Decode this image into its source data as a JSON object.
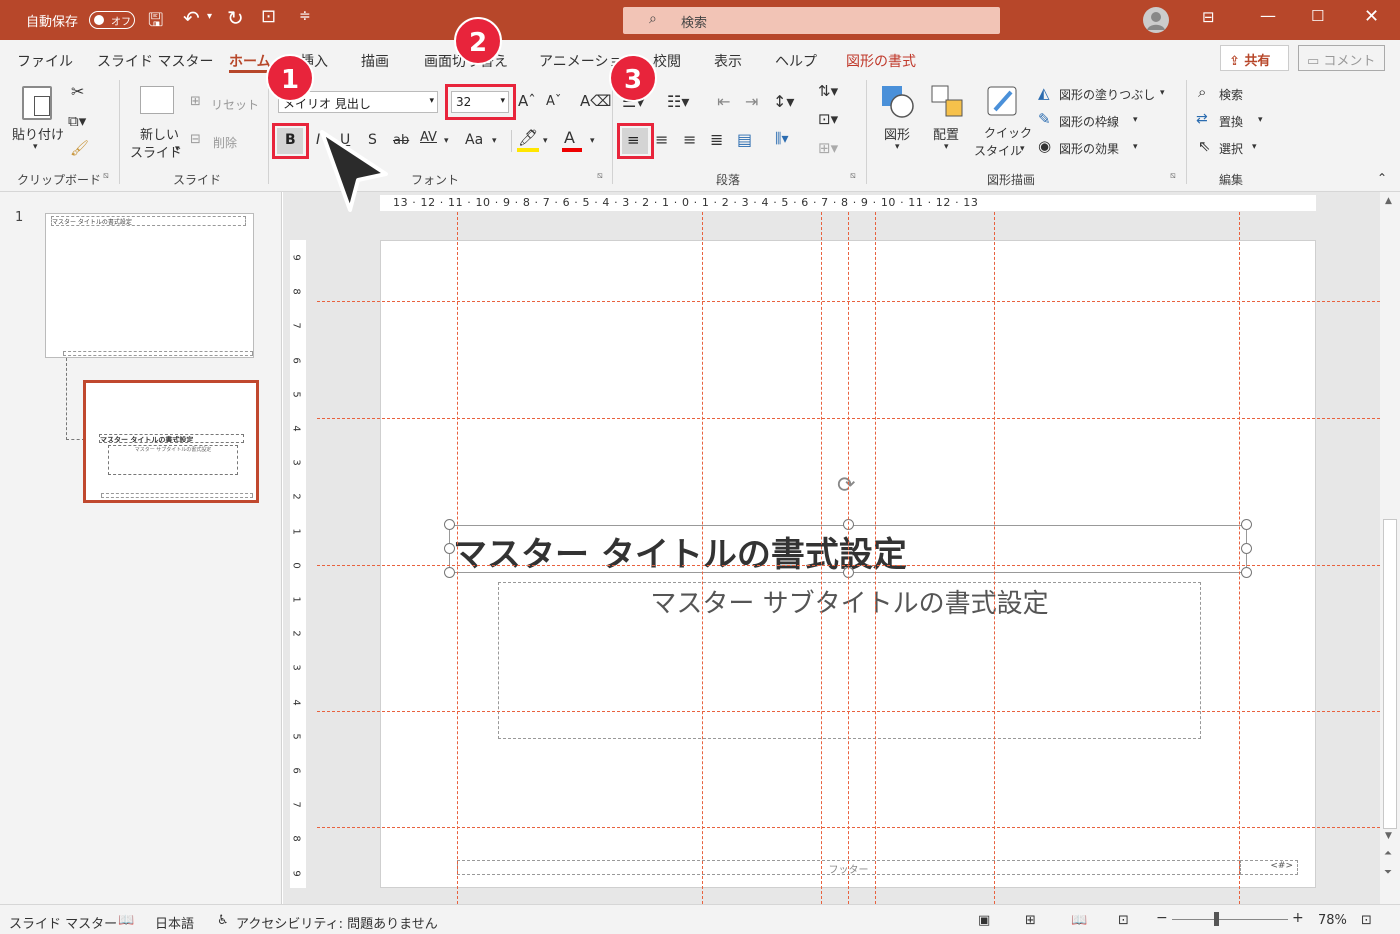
{
  "titlebar": {
    "autosave_label": "自動保存",
    "autosave_state": "オフ",
    "search_placeholder": "検索"
  },
  "tabs": [
    {
      "label": "ファイル"
    },
    {
      "label": "スライド マスター"
    },
    {
      "label": "ホーム"
    },
    {
      "label": "挿入"
    },
    {
      "label": "描画"
    },
    {
      "label": "画面切り替え"
    },
    {
      "label": "アニメーション"
    },
    {
      "label": "校閲"
    },
    {
      "label": "表示"
    },
    {
      "label": "ヘルプ"
    },
    {
      "label": "図形の書式"
    }
  ],
  "share_label": "共有",
  "comment_label": "コメント",
  "ribbon": {
    "clipboard": {
      "paste": "貼り付け",
      "group": "クリップボード"
    },
    "slides": {
      "new_slide_1": "新しい",
      "new_slide_2": "スライド",
      "reset": "リセット",
      "delete": "削除",
      "group": "スライド"
    },
    "font": {
      "font_name": "メイリオ 見出し",
      "font_size": "32",
      "bold": "B",
      "italic": "I",
      "underline": "U",
      "shadow": "S",
      "strike": "ab",
      "spacing": "AV",
      "case": "Aa",
      "group": "フォント"
    },
    "paragraph": {
      "group": "段落"
    },
    "drawing": {
      "shapes": "図形",
      "arrange": "配置",
      "quick_1": "クイック",
      "quick_2": "スタイル",
      "fill": "図形の塗りつぶし",
      "outline": "図形の枠線",
      "effects": "図形の効果",
      "group": "図形描画"
    },
    "editing": {
      "find": "検索",
      "replace": "置換",
      "select": "選択",
      "group": "編集"
    }
  },
  "callouts": [
    "1",
    "2",
    "3"
  ],
  "thumbnails": {
    "slide_number": "1",
    "thumb1_title": "マスター タイトルの書式設定",
    "thumb2_title": "マスター タイトルの書式設定",
    "thumb2_subtitle": "マスター サブタイトルの書式設定"
  },
  "ruler": {
    "horizontal": "13 · 12 · 11 · 10 · 9 · 8 · 7 · 6 · 5 · 4 · 3 · 2 · 1 · 0 · 1 · 2 · 3 · 4 · 5 · 6 · 7 · 8 · 9 · 10 · 11 · 12 · 13",
    "vertical": [
      "9",
      "8",
      "7",
      "6",
      "5",
      "4",
      "3",
      "2",
      "1",
      "0",
      "1",
      "2",
      "3",
      "4",
      "5",
      "6",
      "7",
      "8",
      "9"
    ]
  },
  "slide": {
    "title": "マスター タイトルの書式設定",
    "subtitle": "マスター サブタイトルの書式設定",
    "footer": "フッター",
    "page_number": "<#>"
  },
  "status": {
    "mode": "スライド マスター",
    "language": "日本語",
    "accessibility": "アクセシビリティ: 問題ありません",
    "zoom": "78%"
  },
  "colors": {
    "accent": "#b7472a",
    "callout": "#e8243b",
    "guide": "#e8623f"
  }
}
